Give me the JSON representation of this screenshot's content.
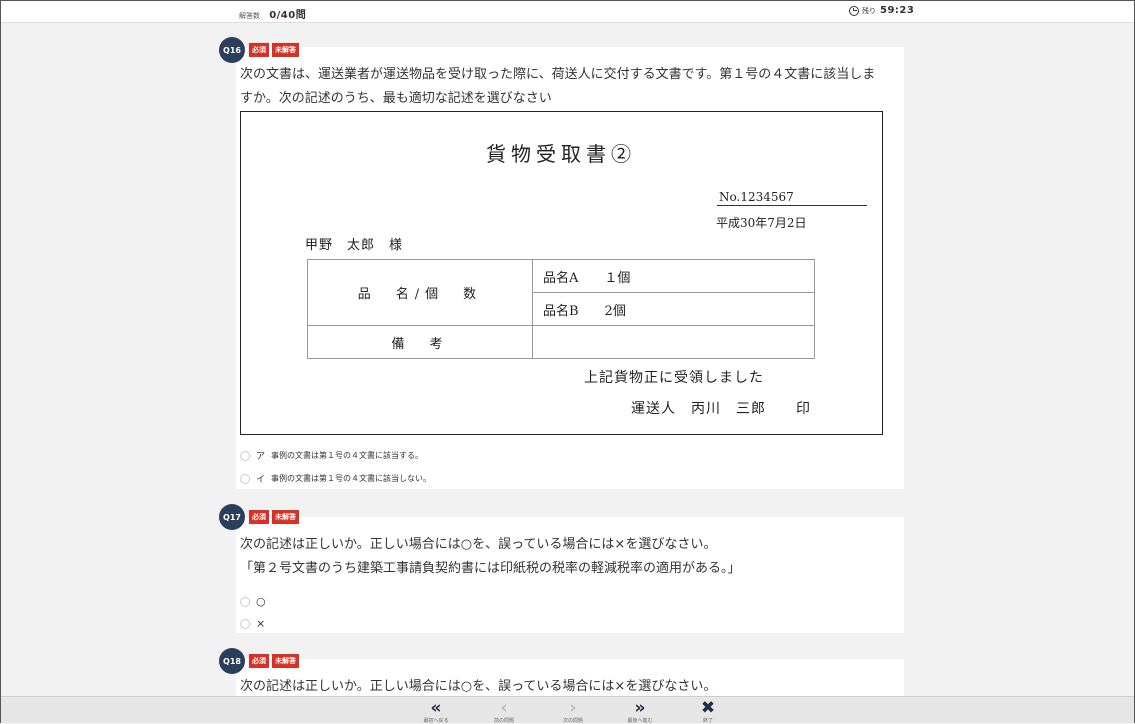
{
  "header": {
    "answered_label": "解答数",
    "answered_count": "0/40問",
    "time_label": "残り",
    "time_value": "59:23"
  },
  "questions": [
    {
      "number": "Q16",
      "badges": [
        "必須",
        "未解答"
      ],
      "text_lines": [
        "次の文書は、運送業者が運送物品を受け取った際に、荷送人に交付する文書です。第１号の４文書に該当しま",
        "すか。次の記述のうち、最も適切な記述を選びなさい"
      ],
      "document": {
        "title": "貨物受取書②",
        "number": "No.1234567",
        "date": "平成30年7月2日",
        "addressee": "甲野　太郎　様",
        "item_label": "品　名/個　数",
        "items": [
          "品名A　　１個",
          "品名B　　2個"
        ],
        "remarks_label": "備　考",
        "remarks_value": "",
        "received": "上記貨物正に受領しました",
        "carrier": "運送人　丙川　三郎　　印"
      },
      "options": [
        {
          "key": "ア",
          "text": "事例の文書は第１号の４文書に該当する。"
        },
        {
          "key": "イ",
          "text": "事例の文書は第１号の４文書に該当しない。"
        }
      ]
    },
    {
      "number": "Q17",
      "badges": [
        "必須",
        "未解答"
      ],
      "text_lines": [
        "次の記述は正しいか。正しい場合には○を、誤っている場合には×を選びなさい。",
        "「第２号文書のうち建築工事請負契約書には印紙税の税率の軽減税率の適用がある。」"
      ],
      "options": [
        {
          "text": "○"
        },
        {
          "text": "×"
        }
      ]
    },
    {
      "number": "Q18",
      "badges": [
        "必須",
        "未解答"
      ],
      "text_lines": [
        "次の記述は正しいか。正しい場合には○を、誤っている場合には×を選びなさい。"
      ]
    }
  ],
  "footer": {
    "buttons": [
      {
        "icon": "«",
        "label": "最初へ戻る",
        "state": "enabled"
      },
      {
        "icon": "‹",
        "label": "前の問題",
        "state": "disabled"
      },
      {
        "icon": "›",
        "label": "次の問題",
        "state": "disabled"
      },
      {
        "icon": "»",
        "label": "最後へ進む",
        "state": "enabled"
      },
      {
        "icon": "✖",
        "label": "終了",
        "state": "enabled"
      }
    ]
  },
  "colors": {
    "badge": "#d93025",
    "question_circle": "#2b3f5c",
    "nav_icon": "#1f2f4a"
  }
}
